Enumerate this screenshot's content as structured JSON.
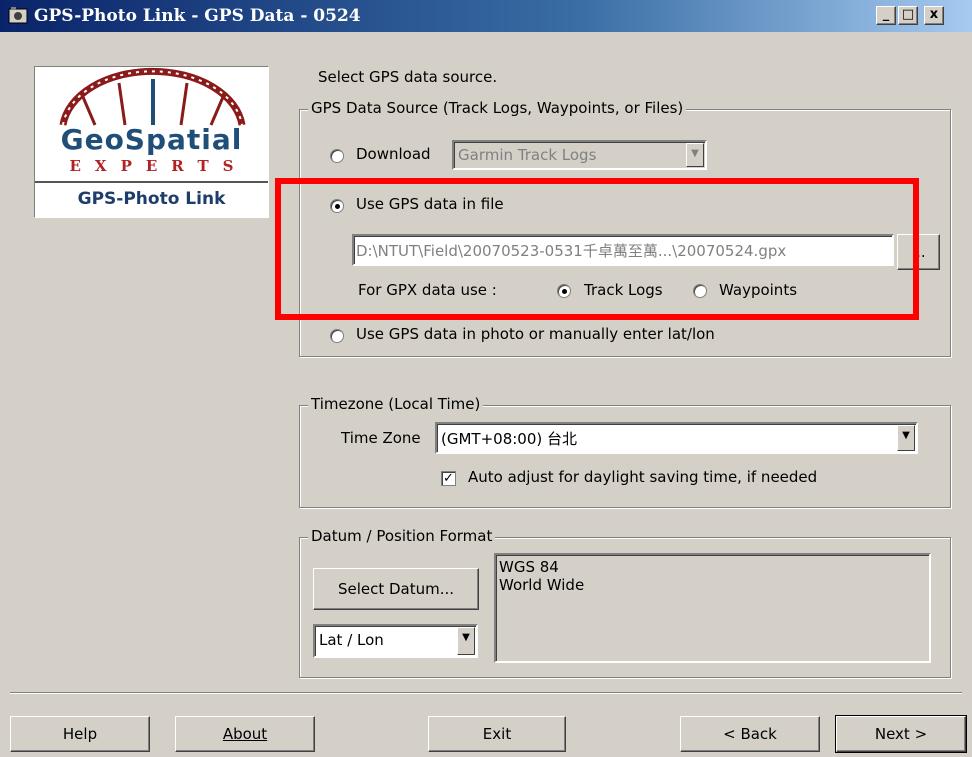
{
  "window": {
    "title": "GPS-Photo Link  - GPS Data - 0524",
    "controls": {
      "minimize": "_",
      "maximize": "□",
      "close": "x"
    }
  },
  "logo": {
    "line1": "GeoSpatial",
    "line2": "EXPERTS",
    "line3": "GPS-Photo Link"
  },
  "instruction": "Select GPS data source.",
  "source_group": {
    "legend": "GPS Data Source (Track Logs, Waypoints, or Files)",
    "download_label": "Download",
    "download_combo": "Garmin Track Logs",
    "file_label": "Use GPS data in file",
    "file_path": "D:\\NTUT\\Field\\20070523-0531千卓萬至萬...\\20070524.gpx",
    "browse_label": "...",
    "gpx_use_label": "For GPX data use :",
    "track_logs_label": "Track Logs",
    "waypoints_label": "Waypoints",
    "photo_label": "Use GPS data in photo or manually enter lat/lon",
    "selected": "file",
    "gpx_selected": "track_logs"
  },
  "timezone_group": {
    "legend": "Timezone (Local Time)",
    "label": "Time Zone",
    "value": "(GMT+08:00) 台北",
    "daylight_label": "Auto adjust for daylight saving time, if needed",
    "daylight_checked": true
  },
  "datum_group": {
    "legend": "Datum / Position Format",
    "select_button": "Select Datum...",
    "format_value": "Lat / Lon",
    "datum_line1": "WGS 84",
    "datum_line2": "World Wide"
  },
  "buttons": {
    "help": "Help",
    "about": "About",
    "exit": "Exit",
    "back": "< Back",
    "next": "Next >"
  },
  "colors": {
    "highlight": "#ff0000",
    "dialog_bg": "#d4d0c8",
    "title_bar": "#0a246a"
  }
}
